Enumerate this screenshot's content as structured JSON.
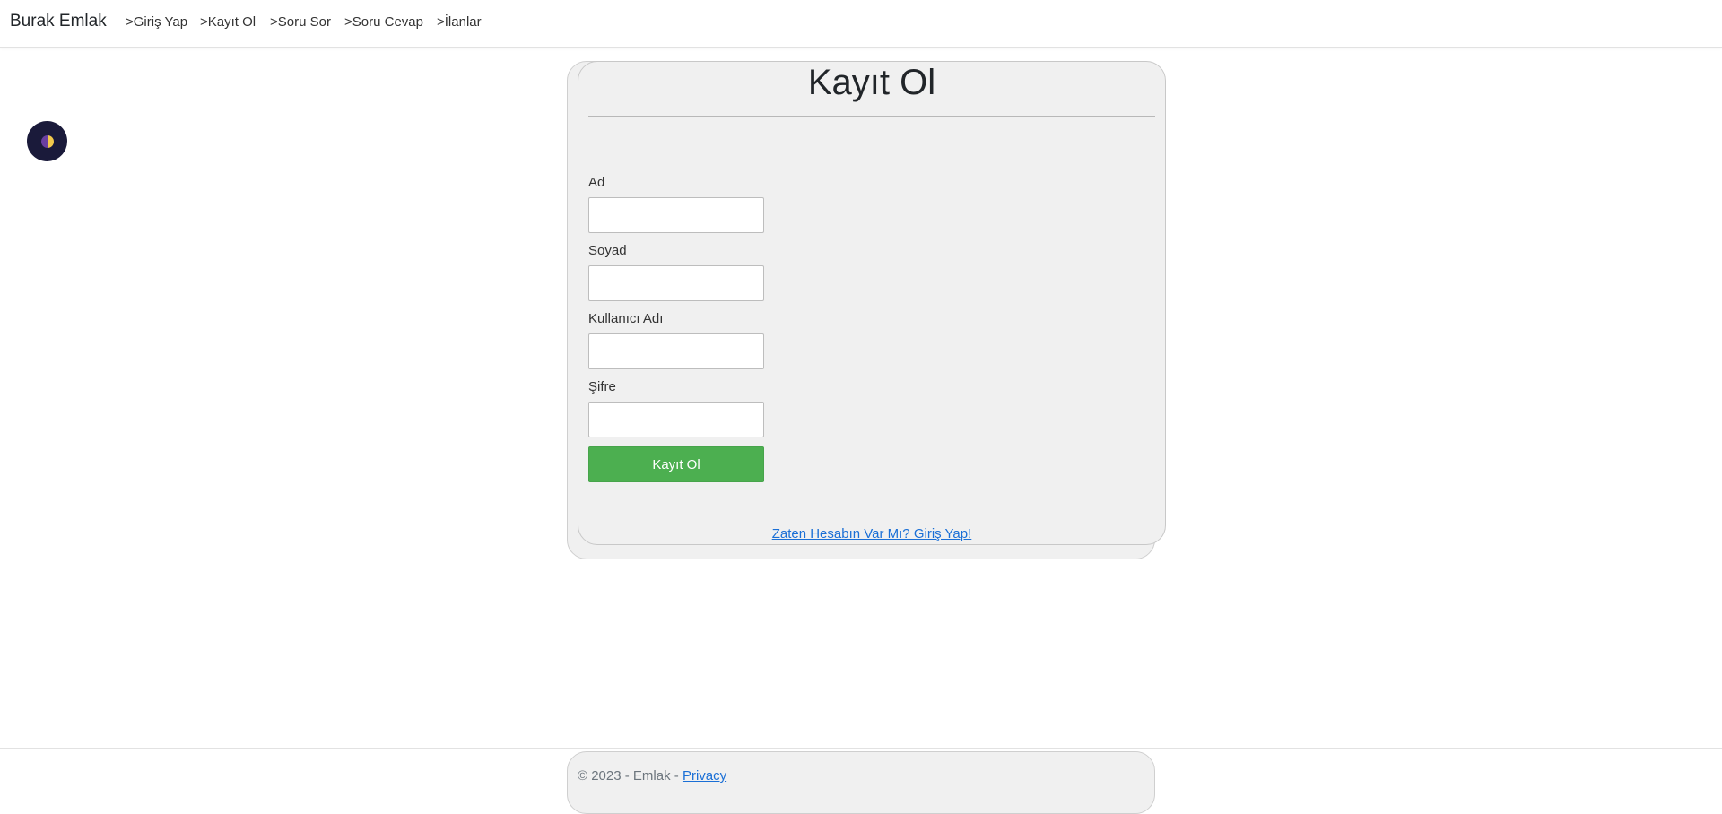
{
  "navbar": {
    "brand": "Burak Emlak",
    "items": [
      {
        "label": ">Giriş Yap"
      },
      {
        "label": ">Kayıt Ol"
      },
      {
        "label": ">Soru Sor"
      },
      {
        "label": ">Soru Cevap"
      },
      {
        "label": ">İlanlar"
      }
    ]
  },
  "theme_toggle": {
    "icon": "half-moon-icon",
    "colors": {
      "background": "#1a1a3a",
      "left_half": "#6a3fa0",
      "right_half": "#f2c94c"
    }
  },
  "form": {
    "title": "Kayıt Ol",
    "fields": [
      {
        "label": "Ad",
        "value": "",
        "placeholder": ""
      },
      {
        "label": "Soyad",
        "value": "",
        "placeholder": ""
      },
      {
        "label": "Kullanıcı Adı",
        "value": "",
        "placeholder": ""
      },
      {
        "label": "Şifre",
        "value": "",
        "placeholder": ""
      }
    ],
    "submit_label": "Kayıt Ol",
    "submit_color": "#4caf50",
    "login_link": "Zaten Hesabın Var Mı? Giriş Yap!"
  },
  "footer": {
    "text": "© 2023 - Emlak - ",
    "privacy_link": "Privacy"
  }
}
